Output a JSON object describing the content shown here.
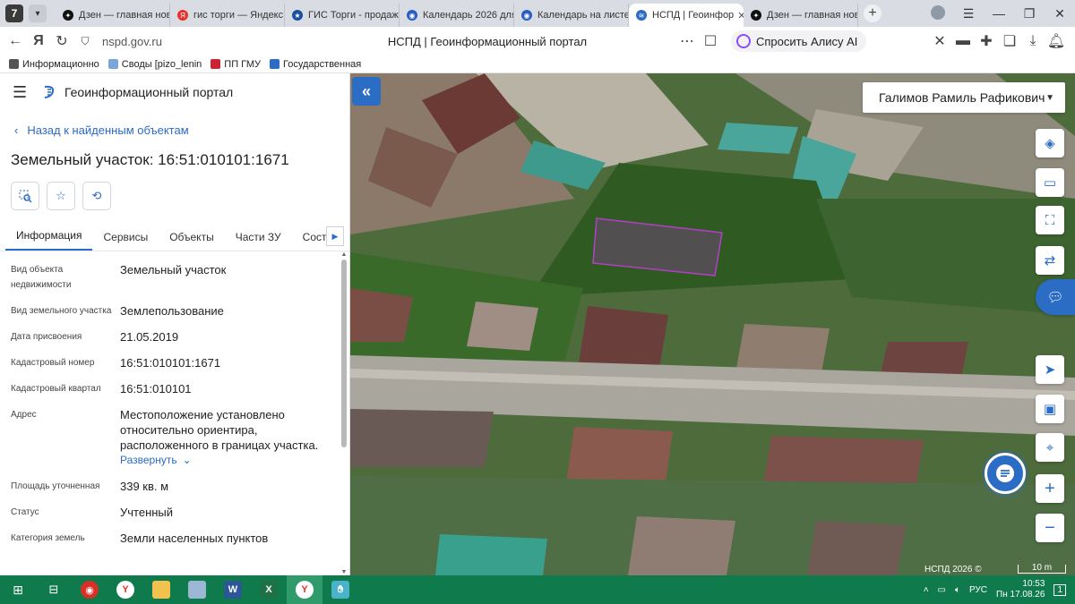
{
  "browser": {
    "tab_counter": "7",
    "tabs": [
      {
        "label": "Дзен — главная нов",
        "color": "#111111"
      },
      {
        "label": "гис торги — Яндекс",
        "color": "#e5322d"
      },
      {
        "label": "ГИС Торги - продаж",
        "color": "#1a4fa0"
      },
      {
        "label": "Календарь 2026 для",
        "color": "#2b5cc4"
      },
      {
        "label": "Календарь на листе",
        "color": "#2b5cc4"
      },
      {
        "label": "НСПД | Геоинфор",
        "color": "#2b6cc4",
        "active": true
      },
      {
        "label": "Дзен — главная нов",
        "color": "#111111"
      }
    ],
    "url": "nspd.gov.ru",
    "page_title": "НСПД | Геоинформационный портал",
    "alice_label": "Спросить Алису AI",
    "bookmarks": [
      "Информационно",
      "Своды [pizo_lenin",
      "ПП ГМУ",
      "Государственная"
    ]
  },
  "panel": {
    "portal_name": "Геоинформационный портал",
    "back_label": "Назад к найденным объектам",
    "title": "Земельный участок: 16:51:010101:1671",
    "tabs": [
      "Информация",
      "Сервисы",
      "Объекты",
      "Части ЗУ",
      "Состав"
    ],
    "rows": [
      {
        "label": "Вид объекта недвижимости",
        "value": "Земельный участок"
      },
      {
        "label": "Вид земельного участка",
        "value": "Землепользование"
      },
      {
        "label": "Дата присвоения",
        "value": "21.05.2019"
      },
      {
        "label": "Кадастровый номер",
        "value": "16:51:010101:1671"
      },
      {
        "label": "Кадастровый квартал",
        "value": "16:51:010101"
      },
      {
        "label": "Адрес",
        "value": "Местоположение установлено относительно ориентира, расположенного в границах участка."
      },
      {
        "label": "Площадь уточненная",
        "value": "339 кв. м"
      },
      {
        "label": "Статус",
        "value": "Учтенный"
      },
      {
        "label": "Категория земель",
        "value": "Земли населенных пунктов"
      }
    ],
    "expand_label": "Развернуть"
  },
  "map": {
    "user_name": "Галимов Рамиль Рафикович",
    "copyright": "НСПД 2026 ©",
    "scale_label": "10 m",
    "parcel_outline_color": "#b43fc7",
    "accent_color": "#2b6cc4"
  },
  "taskbar": {
    "language": "РУС",
    "time": "10:53",
    "date": "Пн 17.08.26",
    "notification_count": "1"
  }
}
